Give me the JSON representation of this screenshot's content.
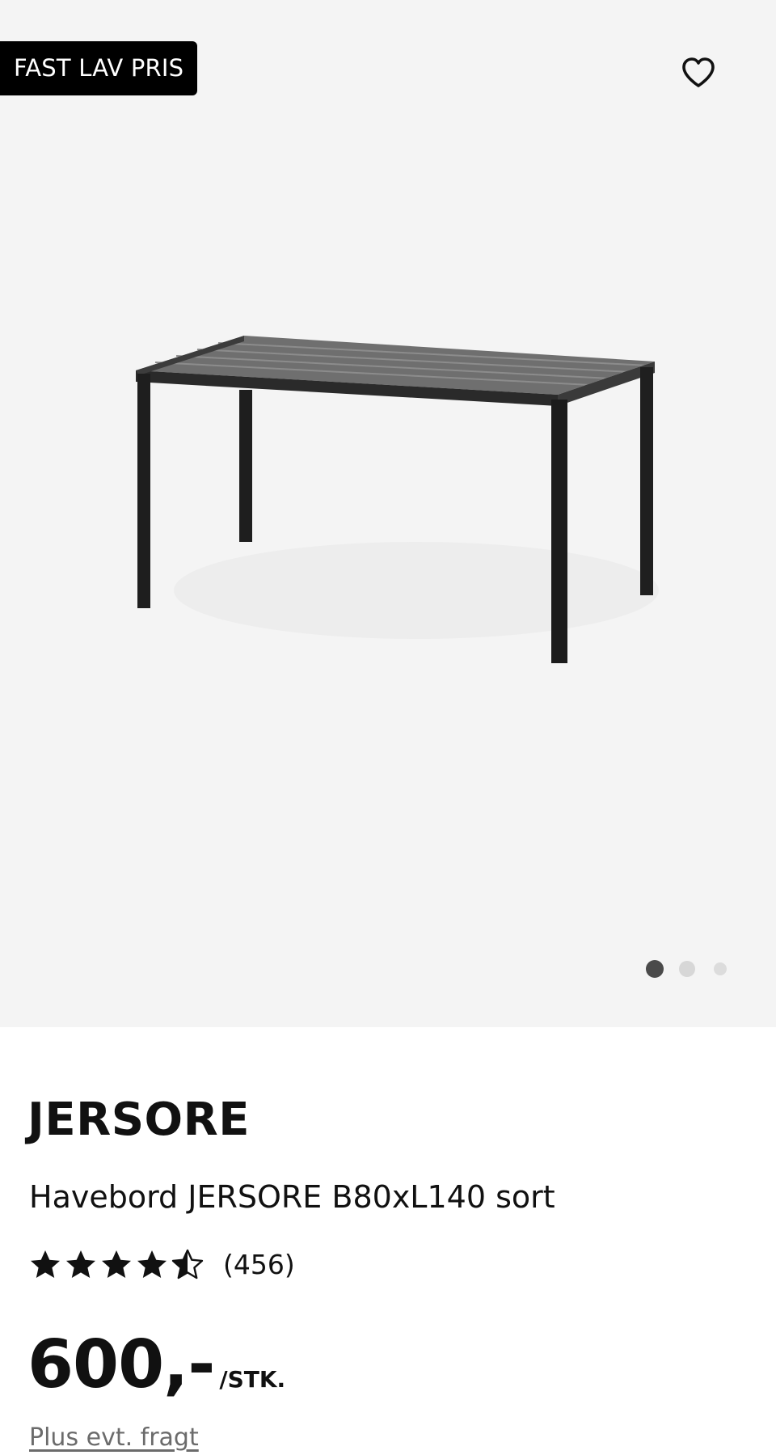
{
  "gallery": {
    "badge": "FAST LAV PRIS",
    "favorite_icon": "heart-outline-icon",
    "image_alt": "Havebord JERSORE B80xL140 sort",
    "slide_count": 3,
    "active_slide": 1,
    "background": "#f4f4f4"
  },
  "product": {
    "brand": "JERSORE",
    "name": "Havebord JERSORE B80xL140 sort",
    "rating": {
      "value": 4.5,
      "max": 5,
      "count_label": "(456)"
    },
    "price": {
      "amount": "600,-",
      "unit": "/STK."
    },
    "shipping_note": "Plus evt. fragt"
  },
  "colors": {
    "badge_bg": "#000000",
    "badge_text": "#ffffff",
    "dot_active": "#4a4a4a",
    "dot_inactive": "#d7d7d7",
    "shipping_text": "#6b6b6b"
  }
}
